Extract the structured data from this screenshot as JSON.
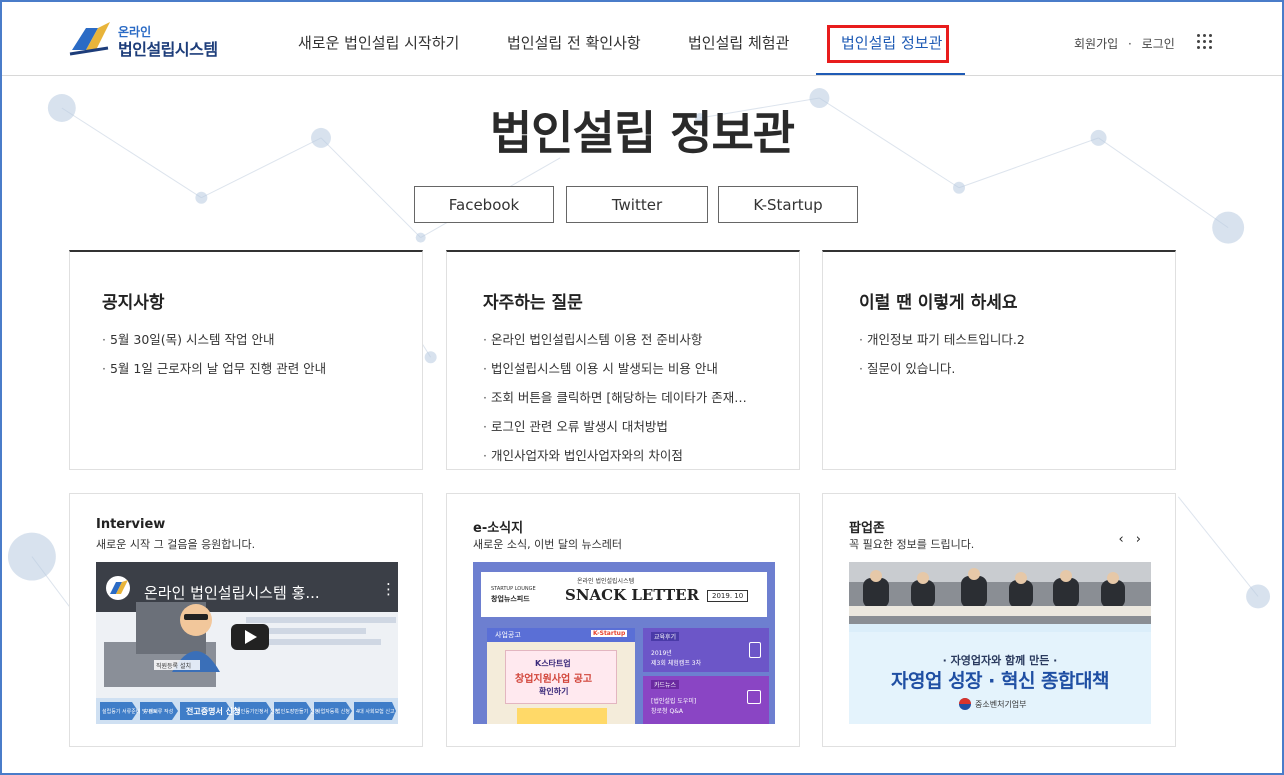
{
  "brand": {
    "line1": "온라인",
    "line2": "법인설립시스템"
  },
  "nav": {
    "items": [
      {
        "label": "새로운 법인설립 시작하기"
      },
      {
        "label": "법인설립 전 확인사항"
      },
      {
        "label": "법인설립 체험관"
      },
      {
        "label": "법인설립 정보관"
      }
    ],
    "active_index": 3
  },
  "auth": {
    "signup": "회원가입",
    "separator": "·",
    "login": "로그인"
  },
  "apps_icon": "grid-dots-icon",
  "hero": {
    "title": "법인설립 정보관"
  },
  "social": {
    "facebook": "Facebook",
    "twitter": "Twitter",
    "kstartup": "K-Startup"
  },
  "notice": {
    "title": "공지사항",
    "items": [
      "5월 30일(목) 시스템 작업 안내",
      "5월 1일 근로자의 날 업무 진행 관련 안내"
    ]
  },
  "faq": {
    "title": "자주하는 질문",
    "items": [
      "온라인 법인설립시스템 이용 전 준비사항",
      "법인설립시스템 이용 시 발생되는 비용 안내",
      "조회 버튼을 클릭하면 [해당하는 데이타가 존재…",
      "로그인 관련 오류 발생시 대처방법",
      "개인사업자와 법인사업자와의 차이점"
    ]
  },
  "howto": {
    "title": "이럴 땐 이렇게 하세요",
    "items": [
      "개인정보 파기 테스트입니다.2",
      "질문이 있습니다."
    ]
  },
  "interview": {
    "title": "Interview",
    "subtitle": "새로운 시작 그 걸음을 응원합니다.",
    "video_title": "온라인 법인설립시스템 홍...",
    "steps": [
      "설립등기 서류준비 및 검토",
      "구비서류 작성",
      "전고증명서 신청",
      "법인등기인정서 신청",
      "법인도장만들기 신청",
      "사업자등록 신청",
      "4대 사회보험 신고"
    ],
    "caption": "직원등록 설치"
  },
  "newsletter": {
    "title": "e-소식지",
    "subtitle": "새로운 소식, 이번 달의 뉴스레터",
    "lounge": "STARTUP LOUNGE",
    "lounge_kr": "창업뉴스피드",
    "system": "온라인 법인설립시스템",
    "name": "SNACK LETTER",
    "issue": "2019. 10",
    "section1": "사업공고",
    "brand": "K-Startup",
    "k_title": "K스타트업",
    "k_sub": "창업지원사업 공고",
    "k_action": "확인하기",
    "r1_tag": "교육후기",
    "r1_text1": "2019년",
    "r1_text2": "제3회 체험캠프 3차",
    "r2_tag": "카드뉴스",
    "r2_text1": "[법인설립 도우미]",
    "r2_text2": "창로청 Q&A"
  },
  "popup": {
    "title": "팝업존",
    "subtitle": "꼭 필요한 정보를 드립니다.",
    "prev": "‹",
    "next": "›",
    "banner_small": "· 자영업자와 함께 만든 ·",
    "banner_big": "자영업 성장 · 혁신 종합대책",
    "ministry": "중소벤처기업부"
  }
}
